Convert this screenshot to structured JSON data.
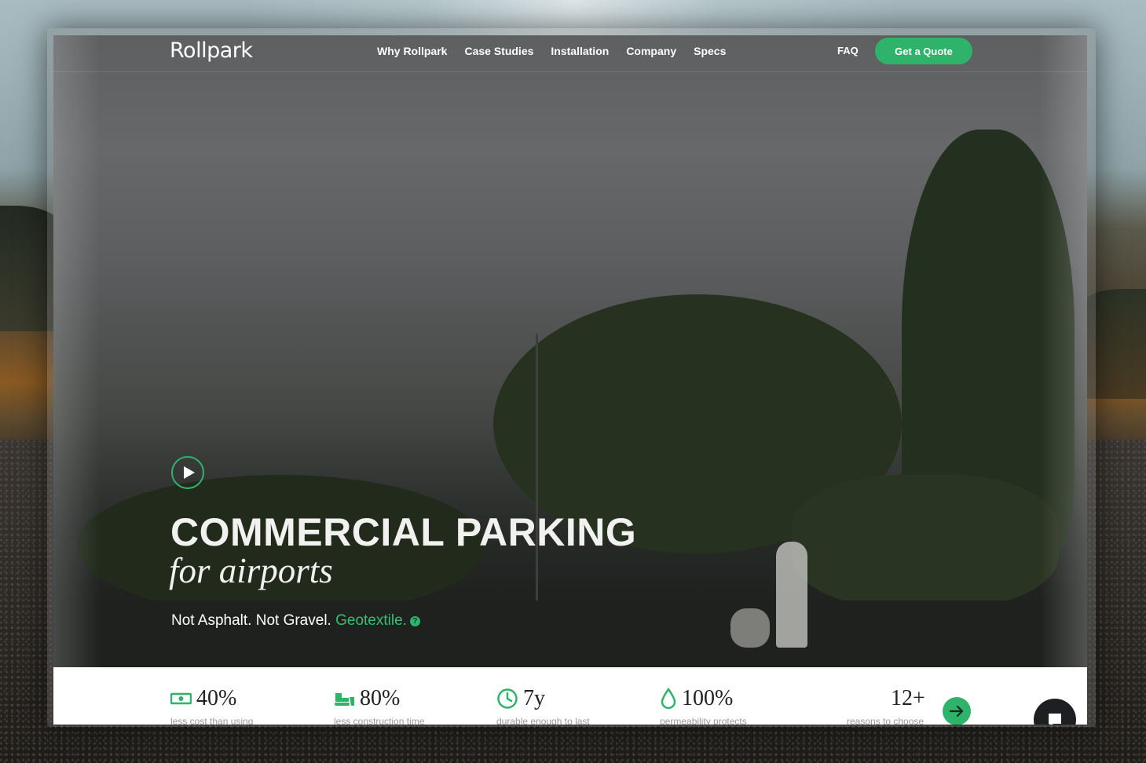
{
  "nav": {
    "logo": "Rollpark",
    "links": [
      "Why Rollpark",
      "Case Studies",
      "Installation",
      "Company",
      "Specs"
    ],
    "faq": "FAQ",
    "cta": "Get a Quote"
  },
  "hero": {
    "headline": "COMMERCIAL PARKING",
    "subhead": "for airports",
    "tagline_part1": "Not Asphalt. Not Gravel. ",
    "tagline_highlight": "Geotextile.",
    "info_glyph": "?"
  },
  "stats": [
    {
      "icon": "cash-icon",
      "value": "40%",
      "desc": "less cost than using"
    },
    {
      "icon": "bulldozer-icon",
      "value": "80%",
      "desc": "less construction time"
    },
    {
      "icon": "clock-icon",
      "value": "7y",
      "desc": "durable enough to last"
    },
    {
      "icon": "droplet-icon",
      "value": "100%",
      "desc": "permeability protects"
    },
    {
      "icon": "",
      "value": "12+",
      "desc": "reasons to choose"
    }
  ],
  "colors": {
    "accent": "#2fb36b",
    "text_light": "#f1f1ef",
    "chat_bg": "#1e1f22"
  }
}
